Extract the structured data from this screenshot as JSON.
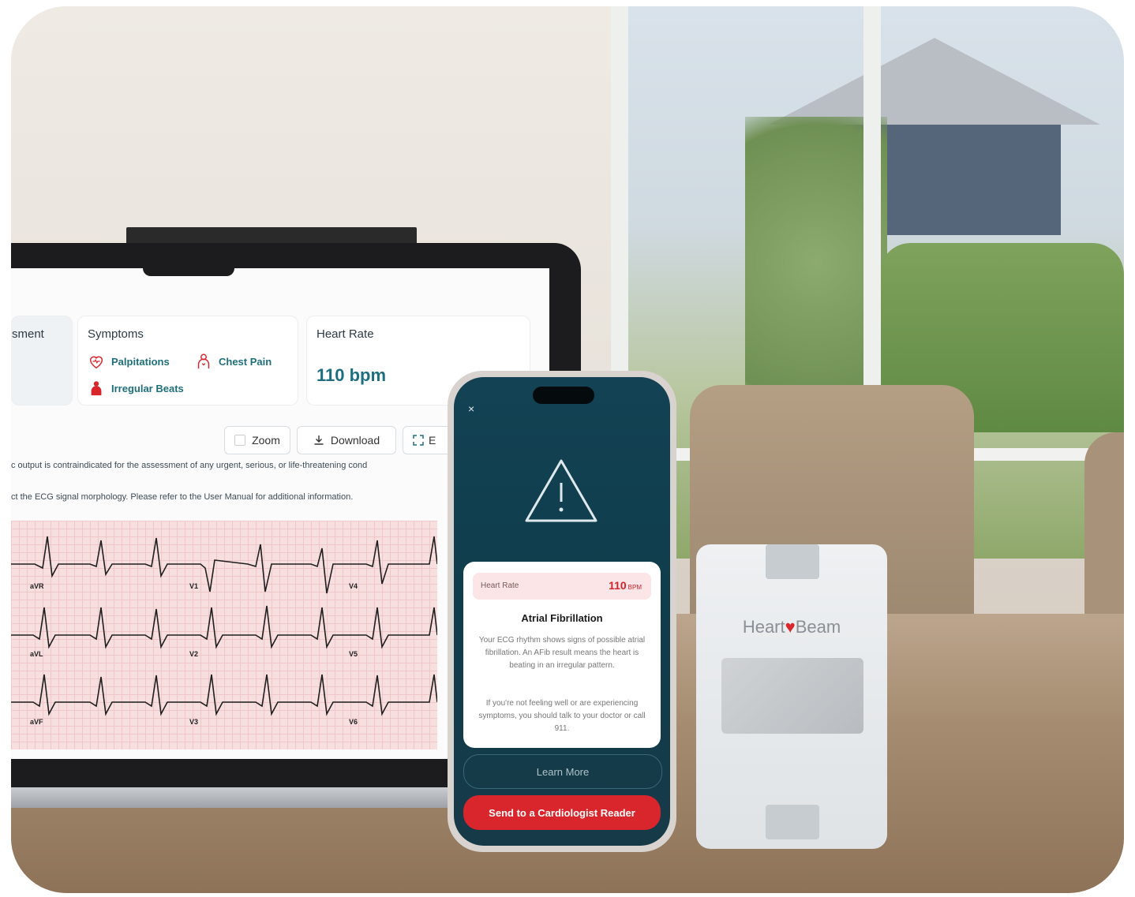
{
  "laptop": {
    "assessment_label": "sment",
    "symptoms": {
      "title": "Symptoms",
      "items": [
        "Palpitations",
        "Chest Pain",
        "Irregular Beats"
      ]
    },
    "heart_rate": {
      "title": "Heart Rate",
      "value": "110 bpm"
    },
    "toolbar": {
      "zoom": "Zoom",
      "download": "Download",
      "expand_partial": "E"
    },
    "notes": [
      "c output is contraindicated for the assessment of any urgent, serious, or life-threatening cond",
      "ct the ECG signal morphology. Please refer to the User Manual for additional information."
    ],
    "ecg_leads": [
      "aVR",
      "V1",
      "V4",
      "aVL",
      "V2",
      "V5",
      "aVF",
      "V3",
      "V6"
    ]
  },
  "phone": {
    "close": "×",
    "heart_rate_label": "Heart Rate",
    "heart_rate_value": "110",
    "heart_rate_unit": "BPM",
    "title": "Atrial Fibrillation",
    "paragraph1": "Your ECG rhythm shows signs of possible atrial fibrillation. An AFib result means the heart is beating in an irregular pattern.",
    "paragraph2": "If you're not feeling well or are experiencing symptoms, you should talk to your doctor or call 911.",
    "learn_more": "Learn More",
    "send_button": "Send to a Cardiologist Reader"
  },
  "device": {
    "brand_left": "Heart",
    "brand_right": "Beam"
  },
  "colors": {
    "accent_teal": "#1e6e80",
    "alert_red": "#d9262d",
    "phone_bg": "#134254"
  }
}
